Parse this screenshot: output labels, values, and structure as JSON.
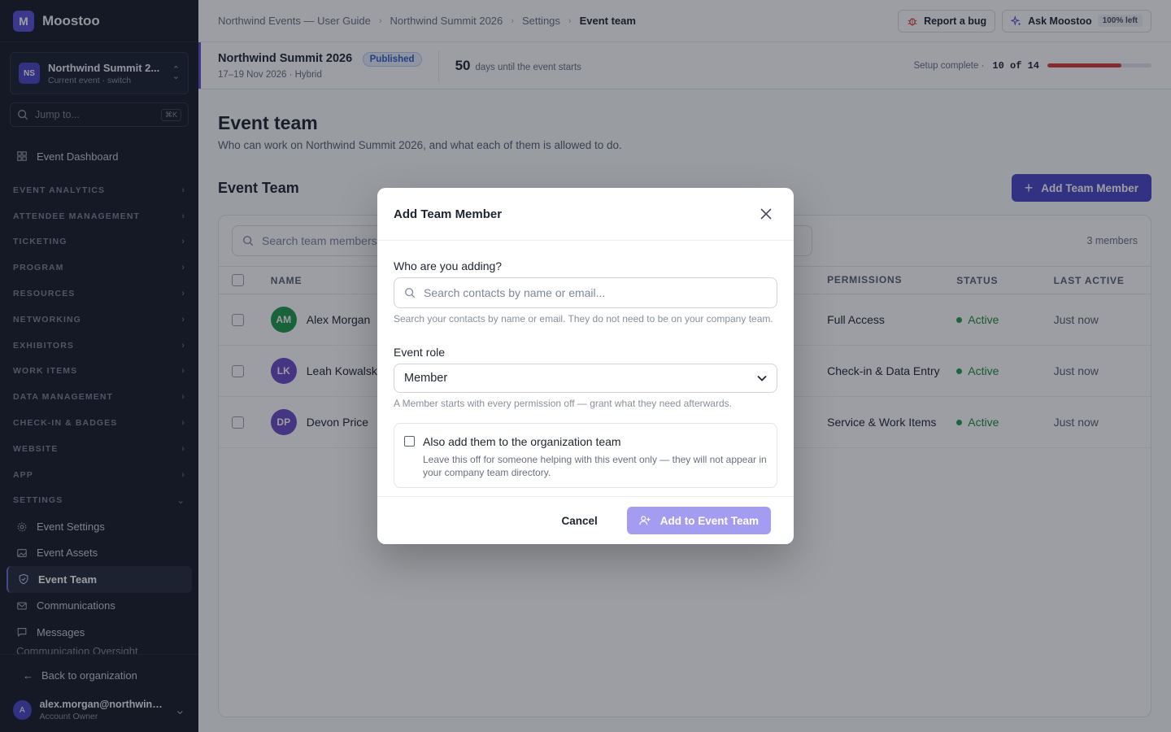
{
  "app": {
    "logo_letter": "M",
    "name": "Moostoo"
  },
  "event_switcher": {
    "badge": "NS",
    "name": "Northwind Summit 2...",
    "sub": "Current event · switch"
  },
  "jump": {
    "placeholder": "Jump to...",
    "shortcut": "⌘K"
  },
  "sidebar": {
    "dashboard": "Event Dashboard",
    "sections": [
      "EVENT ANALYTICS",
      "ATTENDEE MANAGEMENT",
      "TICKETING",
      "PROGRAM",
      "RESOURCES",
      "NETWORKING",
      "EXHIBITORS",
      "WORK ITEMS",
      "DATA MANAGEMENT",
      "CHECK-IN & BADGES",
      "WEBSITE",
      "APP",
      "SETTINGS"
    ],
    "settings_items": [
      "Event Settings",
      "Event Assets",
      "Event Team",
      "Communications",
      "Messages",
      "Communication Oversight"
    ],
    "back": "Back to organization",
    "user_avatar": "A",
    "user_email": "alex.morgan@northwind...",
    "user_role": "Account Owner"
  },
  "breadcrumbs": [
    "Northwind Events — User Guide",
    "Northwind Summit 2026",
    "Settings",
    "Event team"
  ],
  "top_actions": {
    "report": "Report a bug",
    "ask": "Ask Moostoo",
    "ask_pill": "100% left"
  },
  "eventbar": {
    "title": "Northwind Summit 2026",
    "status": "Published",
    "sub": "17–19 Nov 2026 · Hybrid",
    "days": "50",
    "days_label": "days until the event starts",
    "setup_label": "Setup complete ·",
    "setup_value": "10 of 14",
    "setup_done": 10,
    "setup_total": 14
  },
  "page": {
    "title": "Event team",
    "description": "Who can work on Northwind Summit 2026, and what each of them is allowed to do.",
    "section_title": "Event Team",
    "add_button": "Add Team Member"
  },
  "table": {
    "search_placeholder": "Search team members",
    "count": "3 members",
    "headers": {
      "name": "NAME",
      "permissions": "PERMISSIONS",
      "status": "STATUS",
      "last_active": "LAST ACTIVE"
    },
    "rows": [
      {
        "initials": "AM",
        "name": "Alex Morgan",
        "permissions": "Full Access",
        "status": "Active",
        "last": "Just now",
        "color": "#1e9a4a"
      },
      {
        "initials": "LK",
        "name": "Leah Kowalski",
        "permissions": "Check-in & Data Entry",
        "status": "Active",
        "last": "Just now",
        "color": "#6a4bc8"
      },
      {
        "initials": "DP",
        "name": "Devon Price",
        "permissions": "Service & Work Items",
        "status": "Active",
        "last": "Just now",
        "color": "#6a4bc8"
      }
    ]
  },
  "modal": {
    "title": "Add Team Member",
    "who_label": "Who are you adding?",
    "search_placeholder": "Search contacts by name or email...",
    "search_hint": "Search your contacts by name or email. They do not need to be on your company team.",
    "role_label": "Event role",
    "role_value": "Member",
    "role_hint": "A Member starts with every permission off — grant what they need afterwards.",
    "org_check_title": "Also add them to the organization team",
    "org_check_desc": "Leave this off for someone helping with this event only — they will not appear in your company team directory.",
    "cancel": "Cancel",
    "submit": "Add to Event Team"
  }
}
